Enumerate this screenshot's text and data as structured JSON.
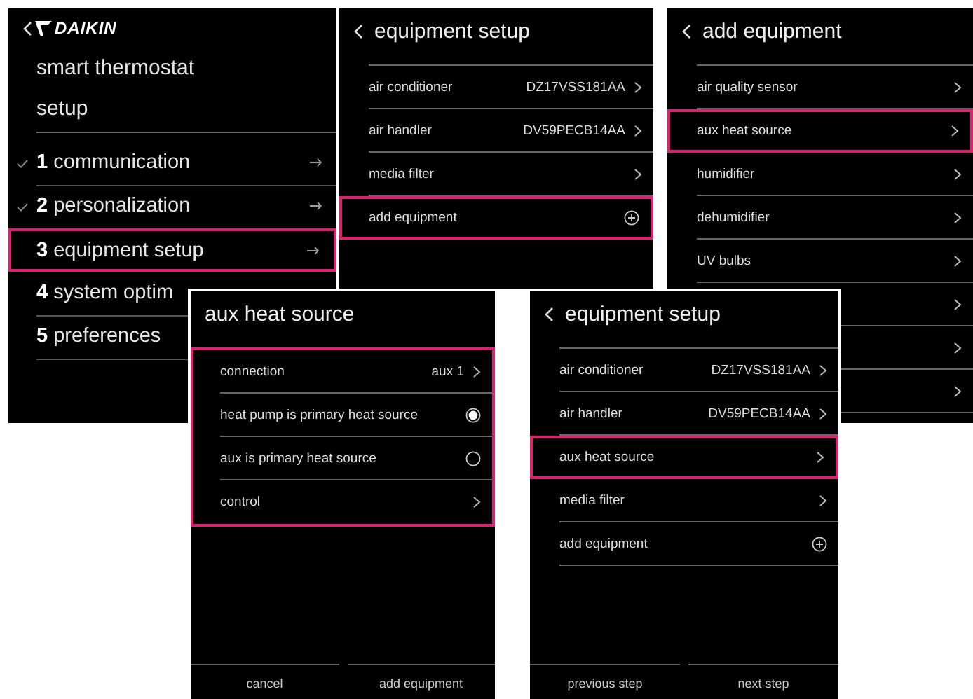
{
  "screens": [
    {
      "kind": "menu",
      "back": true,
      "logo": "DAIKIN",
      "title_lines": [
        "smart thermostat",
        "setup"
      ],
      "steps": [
        {
          "number": "1",
          "label": "communication",
          "arrow": true,
          "done": true,
          "highlighted": false
        },
        {
          "number": "2",
          "label": "personalization",
          "arrow": true,
          "done": true,
          "highlighted": false
        },
        {
          "number": "3",
          "label": "equipment setup",
          "arrow": true,
          "done": false,
          "highlighted": true
        },
        {
          "number": "4",
          "label": "system optim",
          "done": false,
          "highlighted": false
        },
        {
          "number": "5",
          "label": "preferences",
          "done": false,
          "highlighted": false
        }
      ]
    },
    {
      "kind": "list",
      "back": true,
      "title": "equipment setup",
      "list_highlighted": false,
      "items": [
        {
          "kind": "link",
          "label": "air conditioner",
          "value": "DZ17VSS181AA",
          "highlighted": false
        },
        {
          "kind": "link",
          "label": "air handler",
          "value": "DV59PECB14AA",
          "highlighted": false
        },
        {
          "kind": "link",
          "label": "media filter",
          "highlighted": false
        },
        {
          "kind": "add",
          "label": "add equipment",
          "highlighted": true
        }
      ]
    },
    {
      "kind": "list",
      "back": true,
      "title": "add equipment",
      "list_highlighted": false,
      "items": [
        {
          "kind": "link",
          "label": "air quality sensor",
          "highlighted": false
        },
        {
          "kind": "link",
          "label": "aux heat source",
          "highlighted": true
        },
        {
          "kind": "link",
          "label": "humidifier",
          "highlighted": false
        },
        {
          "kind": "link",
          "label": "dehumidifier",
          "highlighted": false
        },
        {
          "kind": "link",
          "label": "UV bulbs",
          "highlighted": false
        },
        {
          "kind": "link",
          "highlighted": false
        },
        {
          "kind": "link",
          "highlighted": false
        },
        {
          "kind": "link",
          "highlighted": false
        }
      ]
    },
    {
      "kind": "list",
      "back": false,
      "title": "aux heat source",
      "list_highlighted": true,
      "items": [
        {
          "kind": "link",
          "label": "connection",
          "value": "aux 1",
          "highlighted": false
        },
        {
          "kind": "radio",
          "label": "heat pump is primary heat source",
          "selected": true,
          "highlighted": false
        },
        {
          "kind": "radio",
          "label": "aux is primary heat source",
          "selected": false,
          "highlighted": false
        },
        {
          "kind": "link",
          "label": "control",
          "highlighted": false
        }
      ],
      "buttons": [
        "cancel",
        "add equipment"
      ]
    },
    {
      "kind": "list",
      "back": true,
      "title": "equipment setup",
      "list_highlighted": false,
      "items": [
        {
          "kind": "link",
          "label": "air conditioner",
          "value": "DZ17VSS181AA",
          "highlighted": false
        },
        {
          "kind": "link",
          "label": "air handler",
          "value": "DV59PECB14AA",
          "highlighted": false
        },
        {
          "kind": "link",
          "label": "aux heat source",
          "highlighted": true
        },
        {
          "kind": "link",
          "label": "media filter",
          "highlighted": false
        },
        {
          "kind": "add",
          "label": "add equipment",
          "highlighted": false
        }
      ],
      "buttons": [
        "previous step",
        "next step"
      ]
    }
  ]
}
